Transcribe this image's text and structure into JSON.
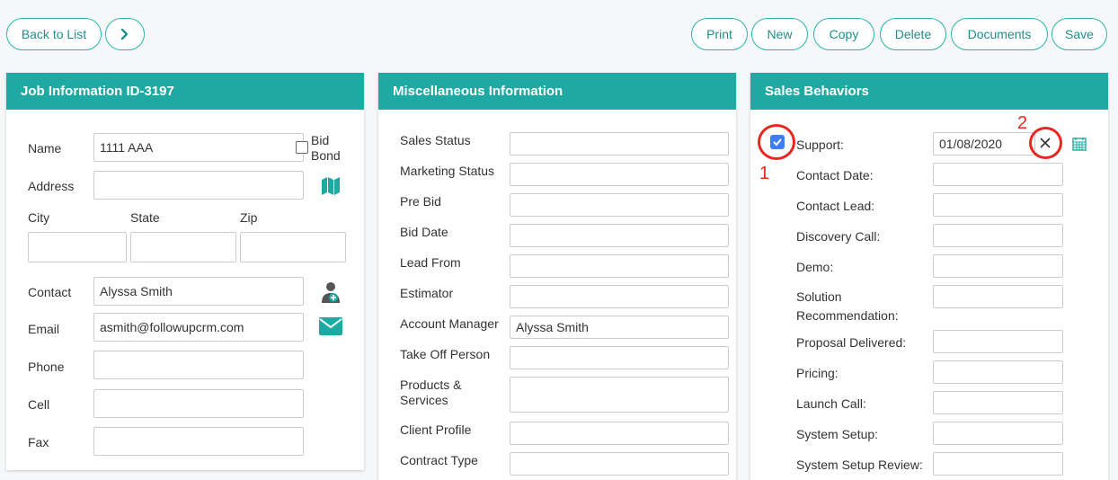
{
  "toolbar": {
    "back_label": "Back to List",
    "print_label": "Print",
    "new_label": "New",
    "copy_label": "Copy",
    "delete_label": "Delete",
    "documents_label": "Documents",
    "save_label": "Save"
  },
  "job": {
    "title": "Job Information ID-3197",
    "name_label": "Name",
    "name_value": "1111 AAA",
    "bid_bond_label_1": "Bid",
    "bid_bond_label_2": "Bond",
    "bid_bond_checked": false,
    "address_label": "Address",
    "address_value": "",
    "city_label": "City",
    "state_label": "State",
    "zip_label": "Zip",
    "city_value": "",
    "state_value": "",
    "zip_value": "",
    "contact_label": "Contact",
    "contact_value": "Alyssa Smith",
    "email_label": "Email",
    "email_value": "asmith@followupcrm.com",
    "phone_label": "Phone",
    "cell_label": "Cell",
    "fax_label": "Fax"
  },
  "misc": {
    "title": "Miscellaneous Information",
    "fields": [
      {
        "label": "Sales Status",
        "value": ""
      },
      {
        "label": "Marketing Status",
        "value": ""
      },
      {
        "label": "Pre Bid",
        "value": ""
      },
      {
        "label": "Bid Date",
        "value": ""
      },
      {
        "label": "Lead From",
        "value": ""
      },
      {
        "label": "Estimator",
        "value": ""
      },
      {
        "label": "Account Manager",
        "value": "Alyssa Smith"
      },
      {
        "label": "Take Off Person",
        "value": ""
      },
      {
        "label_1": "Products &",
        "label_2": "Services",
        "value": ""
      },
      {
        "label": "Client Profile",
        "value": ""
      },
      {
        "label": "Contract Type",
        "value": ""
      }
    ]
  },
  "sales": {
    "title": "Sales Behaviors",
    "support_label": "Support:",
    "support_checked": true,
    "support_date": "01/08/2020",
    "fields": [
      {
        "label": "Contact Date:"
      },
      {
        "label": "Contact Lead:"
      },
      {
        "label": "Discovery Call:"
      },
      {
        "label": "Demo:"
      },
      {
        "label_1": "Solution",
        "label_2": "Recommendation:"
      },
      {
        "label": "Proposal Delivered:"
      },
      {
        "label": "Pricing:"
      },
      {
        "label": "Launch Call:"
      },
      {
        "label": "System Setup:"
      },
      {
        "label": "System Setup Review:"
      }
    ]
  },
  "annotations": {
    "marker_1": "1",
    "marker_2": "2",
    "color": "#e8281e"
  },
  "colors": {
    "accent": "#1eaaa2",
    "button_text": "#1f8f8a"
  },
  "icons": [
    "chevron-right-icon",
    "map-icon",
    "add-contact-icon",
    "envelope-icon",
    "clear-icon",
    "calendar-icon"
  ]
}
